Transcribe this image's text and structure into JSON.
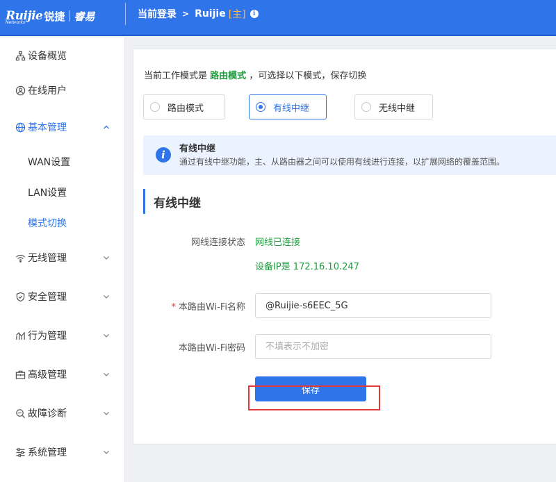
{
  "header": {
    "logo_main": "Ruijie",
    "logo_sub": "Networks",
    "logo_cn": "锐捷",
    "logo_brand2": "睿易",
    "breadcrumb_label": "当前登录",
    "breadcrumb_sep": ">",
    "device_name": "Ruijie",
    "device_tag": "[主]",
    "info_symbol": "i"
  },
  "sidebar": {
    "items": [
      {
        "label": "设备概览",
        "icon": "topology-icon"
      },
      {
        "label": "在线用户",
        "icon": "user-icon"
      },
      {
        "label": "基本管理",
        "icon": "globe-icon",
        "expanded": true
      },
      {
        "label": "无线管理",
        "icon": "wifi-icon"
      },
      {
        "label": "安全管理",
        "icon": "shield-icon"
      },
      {
        "label": "行为管理",
        "icon": "chart-icon"
      },
      {
        "label": "高级管理",
        "icon": "briefcase-icon"
      },
      {
        "label": "故障诊断",
        "icon": "search-icon"
      },
      {
        "label": "系统管理",
        "icon": "sliders-icon"
      }
    ],
    "sub_items": [
      {
        "label": "WAN设置"
      },
      {
        "label": "LAN设置"
      },
      {
        "label": "模式切换",
        "active": true
      }
    ]
  },
  "main": {
    "mode_prefix": "当前工作模式是",
    "current_mode": "路由模式",
    "mode_suffix": "，可选择以下模式，保存切换",
    "modes": [
      {
        "label": "路由模式",
        "selected": false
      },
      {
        "label": "有线中继",
        "selected": true
      },
      {
        "label": "无线中继",
        "selected": false
      }
    ],
    "notice": {
      "title": "有线中继",
      "desc": "通过有线中继功能，主、从路由器之间可以使用有线进行连接，以扩展网络的覆盖范围。",
      "icon_letter": "i"
    },
    "section_title": "有线中继",
    "status_label": "网线连接状态",
    "status_value": "网线已连接",
    "device_ip": "设备IP是 172.16.10.247",
    "required_mark": "*",
    "wifi_name_label": "本路由Wi-Fi名称",
    "wifi_name_value": "@Ruijie-s6EEC_5G",
    "wifi_pwd_label": "本路由Wi-Fi密码",
    "wifi_pwd_placeholder": "不填表示不加密",
    "save_label": "保存"
  },
  "colors": {
    "accent": "#2f74e8",
    "success": "#1a9c3a",
    "highlight": "#e53935"
  }
}
